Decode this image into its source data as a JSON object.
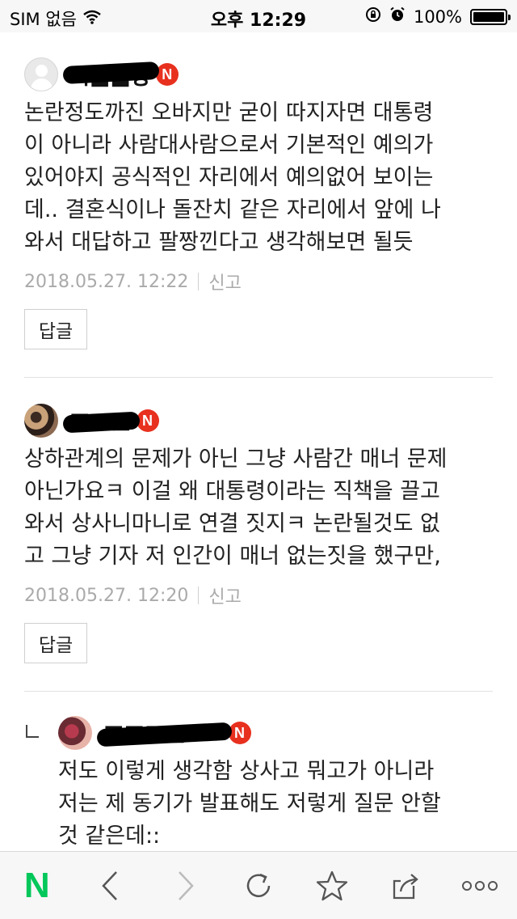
{
  "status_bar": {
    "carrier": "SIM 없음",
    "time": "오후 12:29",
    "battery_percent": "100%",
    "battery_level": 1.0
  },
  "comments": [
    {
      "nickname": "씨■■방",
      "badge": "N",
      "lines": [
        "논란정도까진 오바지만 굳이 따지자면 대통령",
        "이 아니라 사람대사람으로서 기본적인 예의가",
        "있어야지 공식적인 자리에서 예의없어 보이는",
        "데.. 결혼식이나 돌잔치 같은 자리에서 앞에 나",
        "와서 대답하고 팔짱낀다고 생각해보면 될듯"
      ],
      "timestamp": "2018.05.27. 12:22",
      "report": "신고",
      "reply_button": "답글"
    },
    {
      "nickname": "■■■",
      "badge": "N",
      "lines": [
        "상하관계의 문제가 아닌 그냥 사람간 매너 문제",
        "아닌가요ㅋ 이걸 왜 대통령이라는 직책을 끌고",
        "와서 상사니마니로 연결 짓지ㅋ 논란될것도 없",
        "고 그냥 기자 저 인간이 매너 없는짓을 했구만,"
      ],
      "timestamp": "2018.05.27. 12:20",
      "report": "신고",
      "reply_button": "답글"
    }
  ],
  "reply": {
    "nickname": "■■■■me",
    "badge": "N",
    "lines": [
      "저도 이렇게 생각함 상사고 뭐고가 아니라",
      "저는 제 동기가 발표해도 저렇게 질문 안할",
      "것 같은데::"
    ]
  },
  "toolbar": {
    "home_logo": "N",
    "icons": [
      "naver-home-icon",
      "back-icon",
      "forward-icon",
      "refresh-icon",
      "bookmark-star-icon",
      "share-icon",
      "more-icon"
    ]
  },
  "colors": {
    "badge_red": "#e8301f",
    "naver_green": "#03c75a",
    "meta_gray": "#aaaaaa"
  }
}
